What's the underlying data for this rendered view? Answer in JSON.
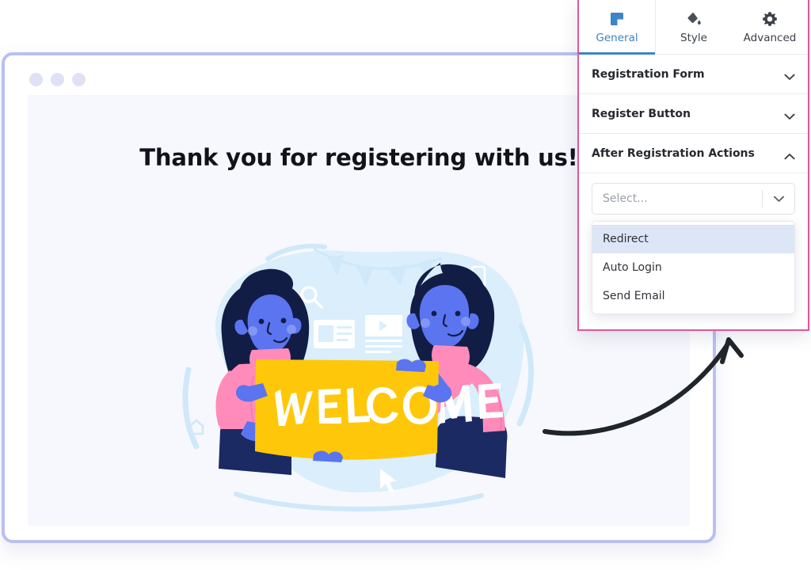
{
  "browser": {
    "dots_count": 3,
    "page": {
      "heading": "Thank you for registering with us!",
      "illustration": {
        "name": "welcome-banner-illustration",
        "banner_text": "WELCOME",
        "banner_color": "#ffc709",
        "shirt_color": "#ff8bba",
        "skin_color": "#5b74f0",
        "hair_color": "#121d46",
        "jeans_color": "#1b2a63",
        "backdrop_color": "#daeefb"
      }
    }
  },
  "annotation": {
    "arrow": "curved-arrow-pointing-to-panel",
    "arrow_color": "#20242b"
  },
  "panel": {
    "border_color": "#e0589a",
    "accent_color": "#3d85c6",
    "tabs": [
      {
        "label": "General",
        "icon": "square-block-icon",
        "active": true
      },
      {
        "label": "Style",
        "icon": "paint-bucket-icon",
        "active": false
      },
      {
        "label": "Advanced",
        "icon": "gear-icon",
        "active": false
      }
    ],
    "sections": [
      {
        "title": "Registration Form",
        "expanded": false,
        "chevron": "chevron-down-icon"
      },
      {
        "title": "Register Button",
        "expanded": false,
        "chevron": "chevron-down-icon"
      },
      {
        "title": "After Registration Actions",
        "expanded": true,
        "chevron": "chevron-up-icon"
      }
    ],
    "select": {
      "value": "",
      "placeholder": "Select...",
      "chevron": "chevron-down-icon"
    },
    "dropdown": {
      "open": true,
      "options": [
        {
          "label": "Redirect",
          "highlighted": true
        },
        {
          "label": "Auto Login",
          "highlighted": false
        },
        {
          "label": "Send Email",
          "highlighted": false
        }
      ]
    }
  }
}
